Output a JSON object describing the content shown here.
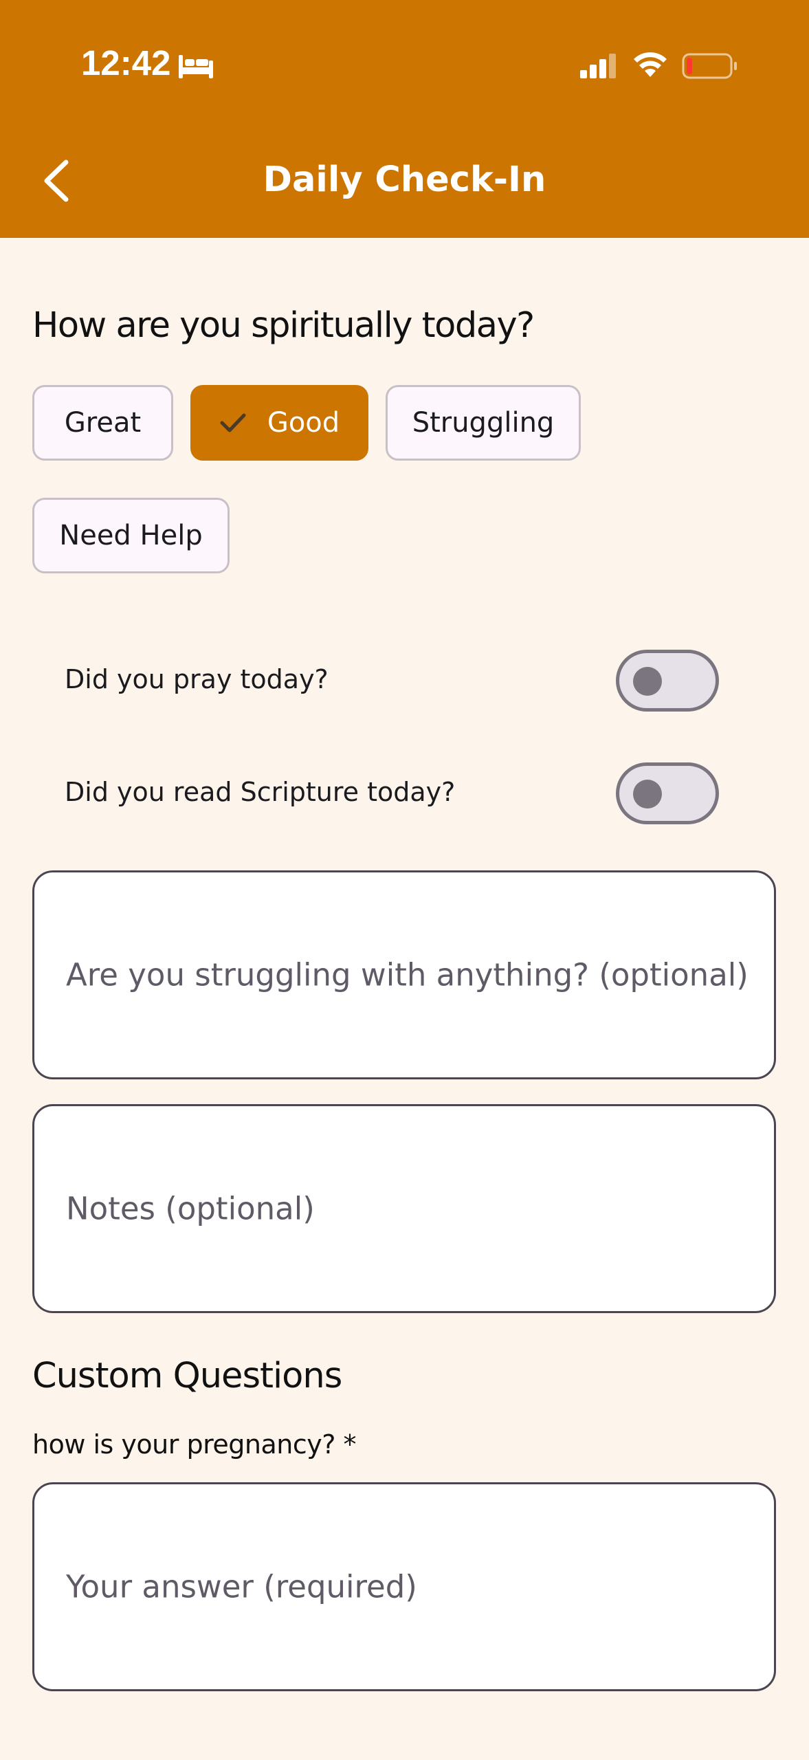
{
  "status_bar": {
    "time": "12:42",
    "icons": [
      "bed-icon",
      "signal-icon",
      "wifi-icon",
      "battery-icon"
    ],
    "battery_level": 0.1
  },
  "app_bar": {
    "title": "Daily Check-In",
    "back_icon": "chevron-left-icon",
    "background": "#cc7500"
  },
  "mood": {
    "question": "How are you spiritually today?",
    "options": [
      {
        "label": "Great",
        "selected": false
      },
      {
        "label": "Good",
        "selected": true
      },
      {
        "label": "Struggling",
        "selected": false
      },
      {
        "label": "Need Help",
        "selected": false
      }
    ],
    "accent": "#cc7500"
  },
  "toggles": [
    {
      "label": "Did you pray today?",
      "on": false
    },
    {
      "label": "Did you read Scripture today?",
      "on": false
    }
  ],
  "fields": {
    "struggling_placeholder": "Are you struggling with anything? (optional)",
    "notes_placeholder": "Notes (optional)"
  },
  "custom": {
    "section_title": "Custom Questions",
    "question": "how is your pregnancy? *",
    "answer_placeholder": "Your answer (required)"
  }
}
